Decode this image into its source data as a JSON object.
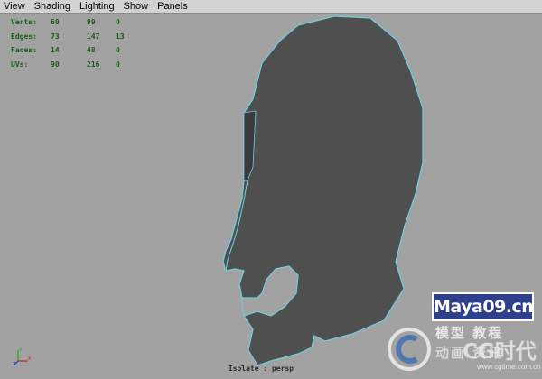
{
  "menu": [
    "View",
    "Shading",
    "Lighting",
    "Show",
    "Panels"
  ],
  "hud": {
    "rows": [
      {
        "label": "Verts:",
        "v1": "60",
        "v2": "99",
        "v3": "0"
      },
      {
        "label": "Edges:",
        "v1": "73",
        "v2": "147",
        "v3": "13"
      },
      {
        "label": "Faces:",
        "v1": "14",
        "v2": "48",
        "v3": "0"
      },
      {
        "label": "UVs:",
        "v1": "90",
        "v2": "216",
        "v3": "0"
      }
    ]
  },
  "viewport": {
    "camera_label": "Isolate : persp",
    "background_color": "#a2a2a2",
    "mesh_color": "#4f4f4f",
    "wire_highlight_color": "#6fd0e0"
  },
  "axis": {
    "x": "X",
    "y": "Y",
    "z": "Z"
  },
  "watermark": {
    "logo_text": "Maya09.cn",
    "cn_line1": "模型 教程",
    "cg_text": "CG时代",
    "cn_line2": "动画 资讯",
    "url": "www.cgtime.com.cn"
  }
}
